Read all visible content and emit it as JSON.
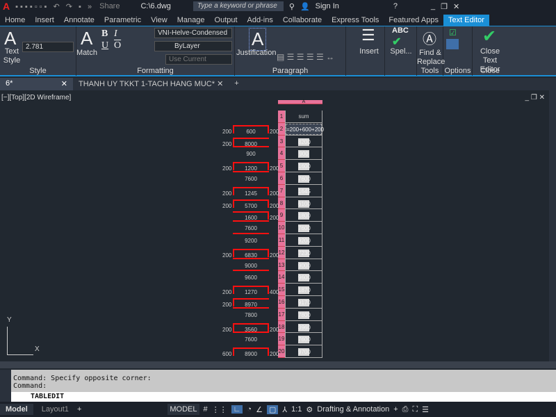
{
  "titlebar": {
    "share": "Share",
    "filename": "C:\\6.dwg",
    "search_placeholder": "Type a keyword or phrase",
    "sign_in": "Sign In"
  },
  "tabs": [
    "Home",
    "Insert",
    "Annotate",
    "Parametric",
    "View",
    "Manage",
    "Output",
    "Add-ins",
    "Collaborate",
    "Express Tools",
    "Featured Apps",
    "Text Editor"
  ],
  "ribbon": {
    "style": {
      "title": "Style",
      "text_style": "Text Style",
      "height": "2.781"
    },
    "formatting": {
      "title": "Formatting",
      "match": "Match",
      "font": "VNI-Helve-Condensed",
      "color": "ByLayer",
      "background": "Use Current"
    },
    "paragraph": {
      "title": "Paragraph",
      "justification": "Justification"
    },
    "insert": {
      "label": "Insert"
    },
    "spell": {
      "label": "Spel..."
    },
    "tools": {
      "title": "Tools",
      "find": "Find & Replace"
    },
    "options": {
      "title": "Options"
    },
    "close": {
      "title": "Close",
      "label": "Close Text Editor"
    }
  },
  "doc_tabs": [
    "6*",
    "THANH UY TKKT 1-TACH HANG MUC*"
  ],
  "viewport": {
    "label": "[−][Top][2D Wireframe]"
  },
  "table": {
    "column": "A",
    "header": "sum",
    "formula": "=200+600+200",
    "rows": [
      {
        "n": "3",
        "left": "200",
        "label": "8000",
        "right": "",
        "shape": "left",
        "value": "8200"
      },
      {
        "n": "4",
        "left": "",
        "label": "900",
        "right": "",
        "shape": "line",
        "value": "900"
      },
      {
        "n": "5",
        "left": "200",
        "label": "1200",
        "right": "200",
        "shape": "bracket",
        "value": "1600"
      },
      {
        "n": "6",
        "left": "",
        "label": "7600",
        "right": "",
        "shape": "line",
        "value": "7600"
      },
      {
        "n": "7",
        "left": "200",
        "label": "1245",
        "right": "200",
        "shape": "bracket",
        "value": "1645"
      },
      {
        "n": "8",
        "left": "200",
        "label": "5700",
        "right": "200",
        "shape": "bracket",
        "value": "6100"
      },
      {
        "n": "9",
        "left": "",
        "label": "1600",
        "right": "200",
        "shape": "right",
        "value": "1800"
      },
      {
        "n": "10",
        "left": "",
        "label": "7600",
        "right": "",
        "shape": "line",
        "value": "7600"
      },
      {
        "n": "11",
        "left": "",
        "label": "9200",
        "right": "",
        "shape": "line",
        "value": "9200"
      },
      {
        "n": "12",
        "left": "200",
        "label": "6830",
        "right": "200",
        "shape": "bracket",
        "value": "7230"
      },
      {
        "n": "13",
        "left": "",
        "label": "9000",
        "right": "",
        "shape": "line",
        "value": "9000"
      },
      {
        "n": "14",
        "left": "",
        "label": "9600",
        "right": "",
        "shape": "line",
        "value": "9600"
      },
      {
        "n": "15",
        "left": "200",
        "label": "1270",
        "right": "400",
        "shape": "bracket",
        "value": "1870"
      },
      {
        "n": "16",
        "left": "200",
        "label": "8970",
        "right": "",
        "shape": "left",
        "value": "9170"
      },
      {
        "n": "17",
        "left": "",
        "label": "7800",
        "right": "",
        "shape": "line",
        "value": "7800"
      },
      {
        "n": "18",
        "left": "200",
        "label": "3560",
        "right": "200",
        "shape": "bracket",
        "value": "3960"
      },
      {
        "n": "19",
        "left": "",
        "label": "7600",
        "right": "",
        "shape": "line",
        "value": "7600"
      },
      {
        "n": "20",
        "left": "600",
        "label": "8900",
        "right": "200",
        "shape": "bracket",
        "value": "9700"
      }
    ],
    "row2": {
      "n": "2",
      "left": "200",
      "label": "600",
      "right": "200"
    },
    "row1": {
      "n": "1"
    }
  },
  "command": {
    "line1": "Command: Specify opposite corner:",
    "line2": "Command:",
    "input": "TABLEDIT"
  },
  "status": {
    "tabs": [
      "Model",
      "Layout1"
    ],
    "model": "MODEL",
    "scale": "1:1",
    "workspace": "Drafting & Annotation"
  },
  "ucs": {
    "y": "Y",
    "x": "X"
  }
}
